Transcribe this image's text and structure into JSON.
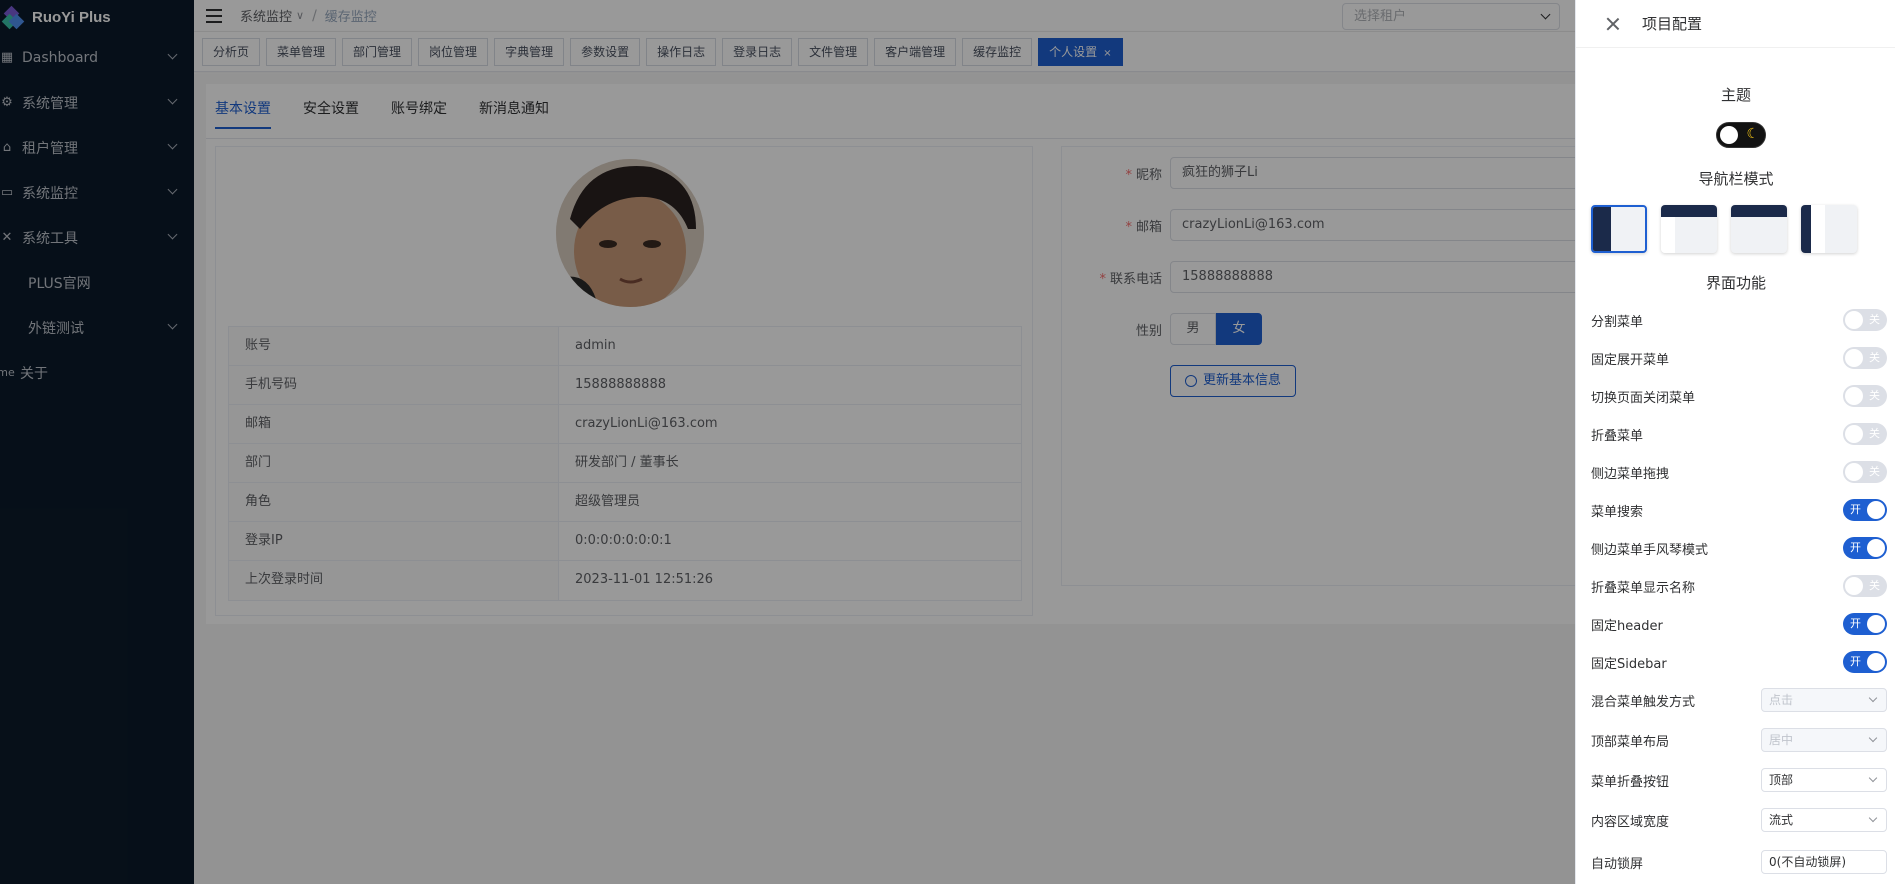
{
  "app": {
    "logo_text": "RuoYi Plus"
  },
  "sidebar": {
    "items": [
      {
        "label": "Dashboard",
        "icon": "dashboard-icon",
        "glyph": "▦",
        "has_children": true
      },
      {
        "label": "系统管理",
        "icon": "system-icon",
        "glyph": "⚙",
        "has_children": true
      },
      {
        "label": "租户管理",
        "icon": "home-icon",
        "glyph": "⌂",
        "has_children": true
      },
      {
        "label": "系统监控",
        "icon": "monitor-icon",
        "glyph": "▭",
        "has_children": true
      },
      {
        "label": "系统工具",
        "icon": "tool-icon",
        "glyph": "✕",
        "has_children": true
      },
      {
        "label": "PLUS官网",
        "icon": "",
        "glyph": "",
        "has_children": false
      },
      {
        "label": "外链测试",
        "icon": "",
        "glyph": "",
        "has_children": true
      },
      {
        "label": "关于",
        "icon": "me-icon",
        "glyph": "me",
        "has_children": false
      }
    ]
  },
  "navbar": {
    "breadcrumb": [
      "系统监控",
      "缓存监控"
    ],
    "tenant_placeholder": "选择租户"
  },
  "tags": [
    "分析页",
    "菜单管理",
    "部门管理",
    "岗位管理",
    "字典管理",
    "参数设置",
    "操作日志",
    "登录日志",
    "文件管理",
    "客户端管理",
    "缓存监控",
    "个人设置"
  ],
  "active_tag": "个人设置",
  "profile": {
    "tabs": [
      "基本设置",
      "安全设置",
      "账号绑定",
      "新消息通知"
    ],
    "active_tab": "基本设置",
    "info": [
      {
        "key": "账号",
        "value": "admin"
      },
      {
        "key": "手机号码",
        "value": "15888888888"
      },
      {
        "key": "邮箱",
        "value": "crazyLionLi@163.com"
      },
      {
        "key": "部门",
        "value": "研发部门 / 董事长"
      },
      {
        "key": "角色",
        "value": "超级管理员"
      },
      {
        "key": "登录IP",
        "value": "0:0:0:0:0:0:0:1"
      },
      {
        "key": "上次登录时间",
        "value": "2023-11-01 12:51:26"
      }
    ],
    "form": {
      "nickname_label": "昵称",
      "nickname": "疯狂的狮子Li",
      "email_label": "邮箱",
      "email": "crazyLionLi@163.com",
      "phone_label": "联系电话",
      "phone": "15888888888",
      "gender_label": "性别",
      "gender_options": [
        "男",
        "女"
      ],
      "gender_selected": "女",
      "save_label": "更新基本信息"
    }
  },
  "drawer": {
    "title": "项目配置",
    "theme_title": "主题",
    "nav_mode_title": "导航栏模式",
    "ui_title": "界面功能",
    "switches": [
      {
        "label": "分割菜单",
        "on": false
      },
      {
        "label": "固定展开菜单",
        "on": false
      },
      {
        "label": "切换页面关闭菜单",
        "on": false
      },
      {
        "label": "折叠菜单",
        "on": false
      },
      {
        "label": "侧边菜单拖拽",
        "on": false
      },
      {
        "label": "菜单搜索",
        "on": true
      },
      {
        "label": "侧边菜单手风琴模式",
        "on": true
      },
      {
        "label": "折叠菜单显示名称",
        "on": false
      },
      {
        "label": "固定header",
        "on": true
      },
      {
        "label": "固定Sidebar",
        "on": true
      }
    ],
    "switch_on_text": "开",
    "switch_off_text": "关",
    "selects": [
      {
        "label": "混合菜单触发方式",
        "value": "点击",
        "disabled": true
      },
      {
        "label": "顶部菜单布局",
        "value": "居中",
        "disabled": true
      },
      {
        "label": "菜单折叠按钮",
        "value": "顶部",
        "disabled": false
      },
      {
        "label": "内容区域宽度",
        "value": "流式",
        "disabled": false
      }
    ],
    "autolock": {
      "label": "自动锁屏",
      "value": "0(不自动锁屏)"
    }
  },
  "colors": {
    "primary": "#1e5fd1",
    "sidebar_bg": "#0b1a2a"
  }
}
